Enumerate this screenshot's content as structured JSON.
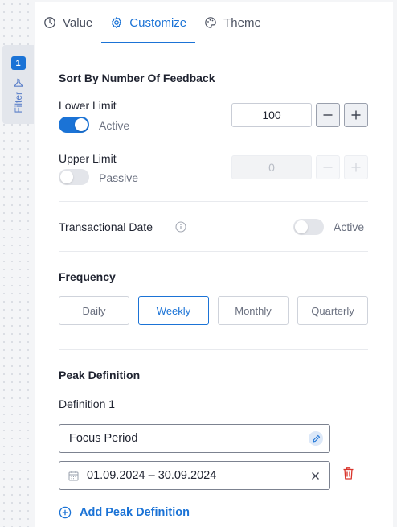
{
  "filter_rail": {
    "badge_count": "1",
    "label": "Filter"
  },
  "tabs": [
    {
      "label": "Value",
      "icon": "history-icon"
    },
    {
      "label": "Customize",
      "icon": "gear-icon",
      "active": true
    },
    {
      "label": "Theme",
      "icon": "palette-icon"
    }
  ],
  "sort_section": {
    "title": "Sort By Number Of Feedback",
    "lower": {
      "label": "Lower Limit",
      "toggle_on": true,
      "status": "Active",
      "value": "100"
    },
    "upper": {
      "label": "Upper Limit",
      "toggle_on": false,
      "status": "Passive",
      "value": "0"
    }
  },
  "transactional": {
    "label": "Transactional Date",
    "toggle_on": false,
    "status": "Active"
  },
  "frequency": {
    "title": "Frequency",
    "options": [
      "Daily",
      "Weekly",
      "Monthly",
      "Quarterly"
    ],
    "selected": "Weekly"
  },
  "peak": {
    "title": "Peak Definition",
    "definition_label": "Definition 1",
    "name_value": "Focus Period",
    "date_range": "01.09.2024 – 30.09.2024",
    "add_label": "Add Peak Definition"
  },
  "colors": {
    "accent": "#1b73d6",
    "delete": "#d9342b"
  }
}
